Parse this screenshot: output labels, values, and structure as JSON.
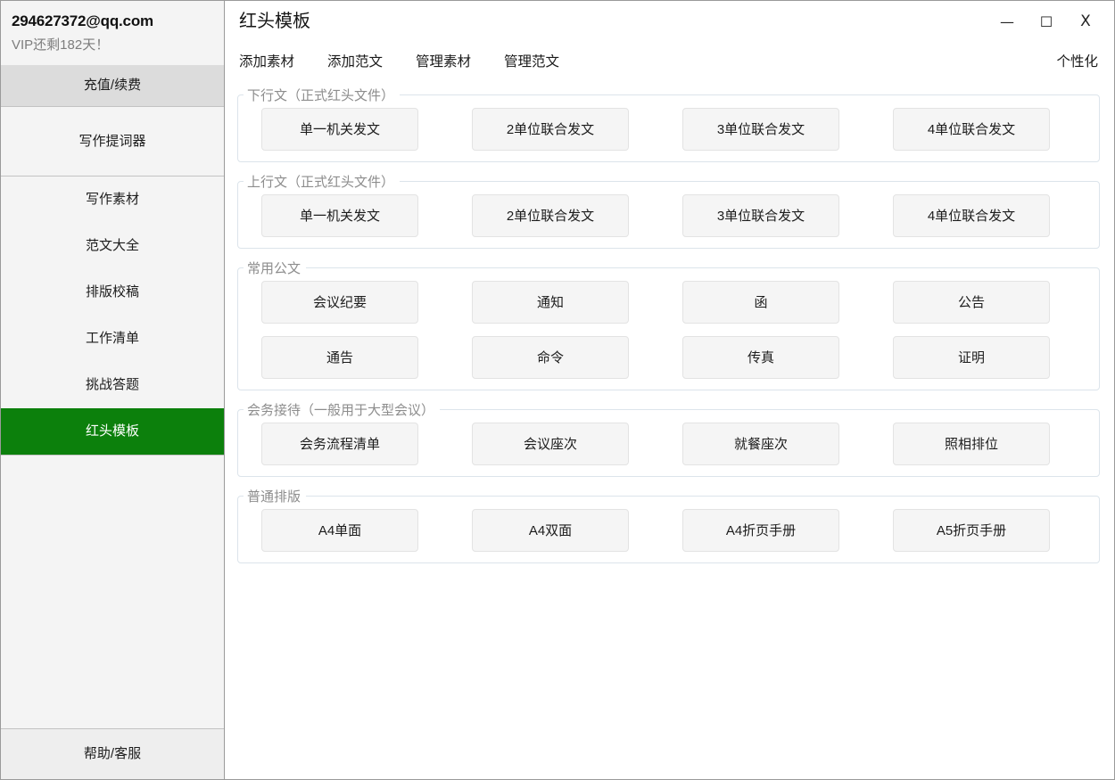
{
  "sidebar": {
    "account_email": "294627372@qq.com",
    "vip_status": "VIP还剩182天！",
    "recharge_label": "充值/续费",
    "prompter_label": "写作提词器",
    "items": [
      {
        "label": "写作素材",
        "active": false
      },
      {
        "label": "范文大全",
        "active": false
      },
      {
        "label": "排版校稿",
        "active": false
      },
      {
        "label": "工作清单",
        "active": false
      },
      {
        "label": "挑战答题",
        "active": false
      },
      {
        "label": "红头模板",
        "active": true
      }
    ],
    "footer_label": "帮助/客服",
    "active_color": "#0c800c",
    "recharge_bg": "#dcdcdc"
  },
  "titlebar": {
    "title": "红头模板",
    "minimize": "—",
    "maximize": "☐",
    "close": "X"
  },
  "menubar": {
    "items": [
      {
        "label": "添加素材"
      },
      {
        "label": "添加范文"
      },
      {
        "label": "管理素材"
      },
      {
        "label": "管理范文"
      }
    ],
    "right_label": "个性化"
  },
  "sections": [
    {
      "legend": "下行文（正式红头文件）",
      "rows": [
        [
          "单一机关发文",
          "2单位联合发文",
          "3单位联合发文",
          "4单位联合发文"
        ]
      ]
    },
    {
      "legend": "上行文（正式红头文件）",
      "rows": [
        [
          "单一机关发文",
          "2单位联合发文",
          "3单位联合发文",
          "4单位联合发文"
        ]
      ]
    },
    {
      "legend": "常用公文",
      "rows": [
        [
          "会议纪要",
          "通知",
          "函",
          "公告"
        ],
        [
          "通告",
          "命令",
          "传真",
          "证明"
        ]
      ]
    },
    {
      "legend": "会务接待（一般用于大型会议）",
      "rows": [
        [
          "会务流程清单",
          "会议座次",
          "就餐座次",
          "照相排位"
        ]
      ]
    },
    {
      "legend": "普通排版",
      "rows": [
        [
          "A4单面",
          "A4双面",
          "A4折页手册",
          "A5折页手册"
        ]
      ]
    }
  ]
}
